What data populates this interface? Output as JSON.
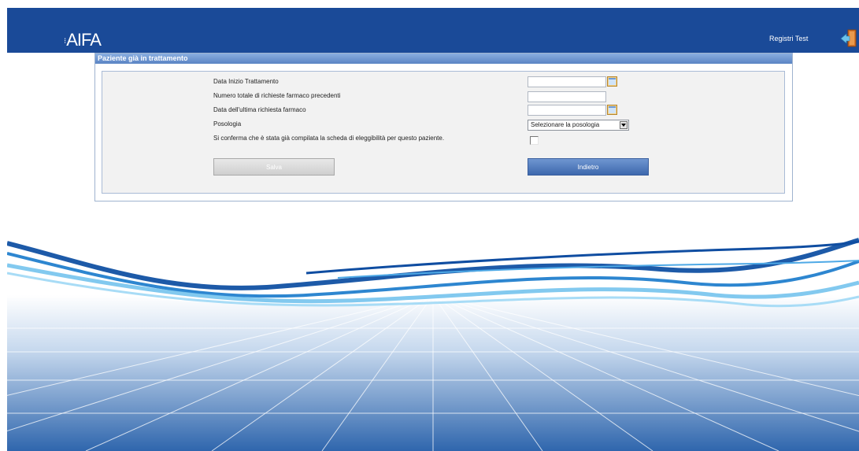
{
  "header": {
    "logo": "AIFA",
    "user_link": "Registri Test",
    "exit_icon": "exit-door-icon",
    "bg_color": "#1a4a98"
  },
  "panel": {
    "title": "Paziente già in trattamento",
    "rows": [
      {
        "label": "Data Inizio Trattamento",
        "value": ""
      },
      {
        "label": "Numero totale di richieste farmaco precedenti",
        "value": ""
      },
      {
        "label": "Data dell'ultima richiesta farmaco",
        "value": ""
      },
      {
        "label": "Posologia",
        "value": "Selezionare la posologia"
      },
      {
        "label": "Si conferma che è stata già compilata la scheda di eleggibilità per questo paziente.",
        "checked": false
      }
    ],
    "buttons": {
      "save": "Salva",
      "back": "Indietro"
    },
    "calendar_icon": "calendar-icon",
    "accent_color": "#3d68ad"
  }
}
